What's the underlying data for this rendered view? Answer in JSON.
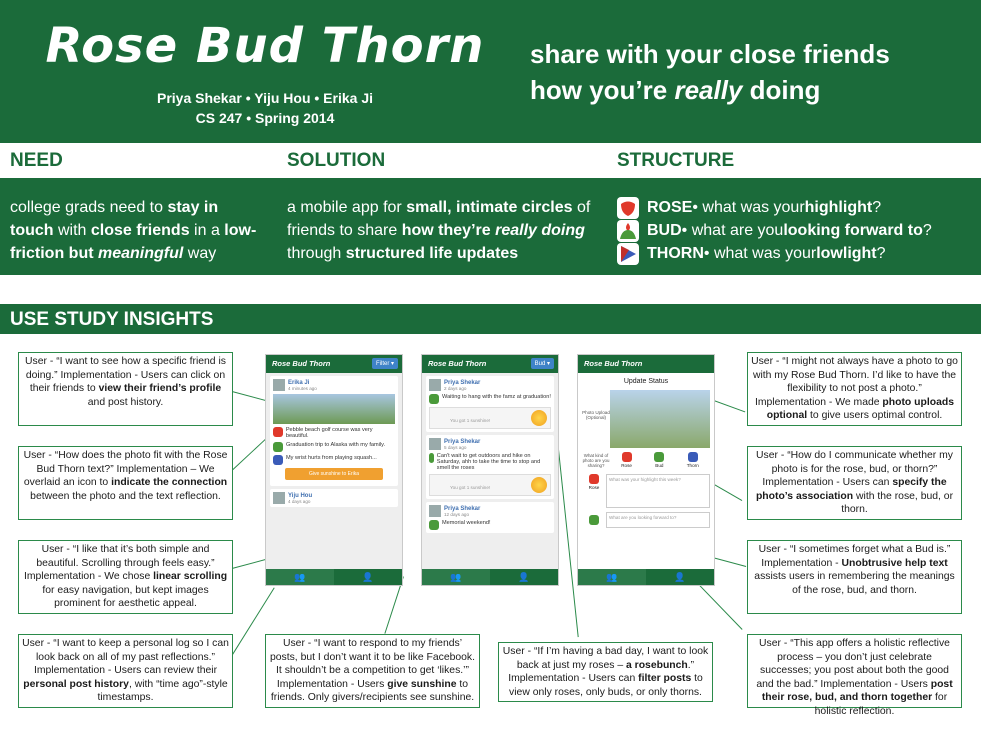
{
  "header": {
    "title": "Rose Bud Thorn",
    "authors": "Priya Shekar • Yiju Hou • Erika Ji",
    "course": "CS 247 • Spring 2014",
    "tagline_1": "share with your close friends",
    "tagline_2a": "how you’re ",
    "tagline_2b": "really",
    "tagline_2c": " doing"
  },
  "need": {
    "heading": "NEED",
    "t1": "college grads need to ",
    "b1": "stay in touch",
    "t2": " with ",
    "b2": "close friends",
    "t3": " in a ",
    "b3": "low-friction but ",
    "b4": "meaningful",
    "t4": " way"
  },
  "solution": {
    "heading": "SOLUTION",
    "t1": "a mobile app for ",
    "b1": "small, intimate circles",
    "t2": " of friends to share ",
    "b2": "how they’re ",
    "b3": "really doing",
    "t3": " through ",
    "b4": "structured life updates"
  },
  "structure": {
    "heading": "STRUCTURE",
    "rows": [
      {
        "name": "ROSE",
        "text": " • what was your ",
        "bold": "highlight",
        "end": "?"
      },
      {
        "name": "BUD",
        "text": " • what are you ",
        "bold": "looking forward to",
        "end": "?"
      },
      {
        "name": "THORN",
        "text": " • what was your ",
        "bold": "lowlight",
        "end": "?"
      }
    ]
  },
  "insights_heading": "USE STUDY INSIGHTS",
  "callouts": {
    "c1": {
      "p1": "User - “I want to see how a specific friend is doing.” Implementation - Users can click on their friends to ",
      "b1": "view their friend’s profile",
      "p2": " and post history."
    },
    "c2": {
      "p1": "User - “How does the photo fit with the Rose Bud Thorn text?” Implementation – We overlaid an icon to ",
      "b1": "indicate the connection",
      "p2": " between the photo and the text reflection."
    },
    "c3": {
      "p1": "User - “I like that it’s both simple and beautiful. Scrolling through feels easy.” Implementation - We chose ",
      "b1": "linear scrolling",
      "p2": " for easy navigation, but kept images prominent for aesthetic appeal."
    },
    "c4": {
      "p1": "User - “I want to keep a personal log so I can look back on all of my past reflections.” Implementation - Users can review their ",
      "b1": "personal post history",
      "p2": ", with “time ago”-style timestamps."
    },
    "c5": {
      "p1": "User - “I want to respond to my friends’ posts, but I don’t want it to be like Facebook. It shouldn’t be a competition to get ‘likes.’” Implementation - Users ",
      "b1": "give sunshine",
      "p2": " to friends. Only givers/recipients see sunshine."
    },
    "c6": {
      "p1": "User - “If I’m having a bad day, I want to look back at just my roses – ",
      "b0": "a rosebunch",
      "p1b": ".” Implementation - Users can ",
      "b1": "filter posts",
      "p2": " to view only roses, only buds, or only thorns."
    },
    "c7": {
      "p1": "User - “I might not always have a photo to go with my Rose Bud Thorn. I’d like to have the flexibility to not post a photo.” Implementation - We made ",
      "b1": "photo uploads optional",
      "p2": " to give users optimal control."
    },
    "c8": {
      "p1": "User - “How do I communicate whether my photo is for the rose, bud, or thorn?” Implementation - Users can ",
      "b1": "specify the photo’s association",
      "p2": " with the rose, bud, or thorn."
    },
    "c9": {
      "p1": "User - “I sometimes forget what a Bud is.” Implementation - ",
      "b1": "Unobtrusive help text",
      "p2": " assists users in remembering the meanings of the rose, bud, and thorn."
    },
    "c10": {
      "p1": "User - “This app offers a holistic reflective process – you don’t just celebrate successes; you post about both the good and the bad.” Implementation - Users ",
      "b1": "post their rose, bud, and thorn together",
      "p2": " for holistic reflection."
    }
  },
  "phone1": {
    "title": "Rose Bud Thorn",
    "button": "Filter ▾",
    "name": "Erika Ji",
    "time": "4 minutes ago",
    "rose": "Pebble beach golf course was very beautiful.",
    "bud": "Graduation trip to Alaska with my family.",
    "thorn": "My wrist hurts from playing squash...",
    "rose_label": "Rose",
    "bud_label": "Bud",
    "thorn_label": "Thorn",
    "sun_button": "Give sunshine to Erika",
    "name2": "Yiju Hou",
    "time2": "4 days ago"
  },
  "phone2": {
    "title": "Rose Bud Thorn",
    "button": "Bud ▾",
    "posts": [
      {
        "name": "Priya Shekar",
        "time": "2 days ago",
        "text": "Waiting to hang with the famz at graduation!",
        "label": "Bud",
        "sun": "You got 1 sunshine!"
      },
      {
        "name": "Priya Shekar",
        "time": "5 days ago",
        "text": "Can't wait to get outdoors and hike on Saturday, ahh to take the time to stop and smell the roses",
        "label": "Bud",
        "sun": "You got 1 sunshine!"
      },
      {
        "name": "Priya Shekar",
        "time": "12 days ago",
        "text": "Memorial weekend!",
        "label": "Bud"
      }
    ]
  },
  "phone3": {
    "title": "Rose Bud Thorn",
    "heading": "Update Status",
    "photo_label": "Photo Upload (Optional)",
    "assoc_label": "What kind of photo are you sharing?",
    "opts": [
      "Rose",
      "Bud",
      "Thorn"
    ],
    "rose_ph": "What was your highlight this week?",
    "bud_ph": "What are you looking forward to?",
    "rose_label": "Rose"
  },
  "colors": {
    "brand": "#1b6b3a",
    "rose": "#e0392b",
    "bud": "#4a9a3a",
    "thorn": "#3a5bb8",
    "accent": "#3f83c8"
  }
}
